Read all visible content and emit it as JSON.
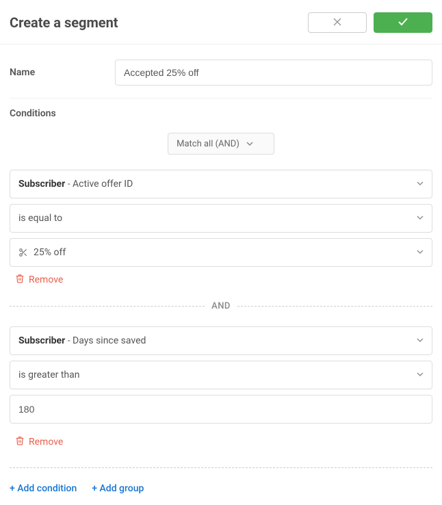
{
  "header": {
    "title": "Create a segment"
  },
  "name": {
    "label": "Name",
    "value": "Accepted 25% off"
  },
  "conditions": {
    "label": "Conditions",
    "match_label": "Match all (AND)",
    "separator": "AND",
    "rules": [
      {
        "category": "Subscriber",
        "field": "Active offer ID",
        "operator": "is equal to",
        "value": "25% off",
        "value_type": "offer",
        "remove_label": "Remove"
      },
      {
        "category": "Subscriber",
        "field": "Days since saved",
        "operator": "is greater than",
        "value": "180",
        "value_type": "number",
        "remove_label": "Remove"
      }
    ],
    "add_condition_label": "+ Add condition",
    "add_group_label": "+ Add group"
  }
}
